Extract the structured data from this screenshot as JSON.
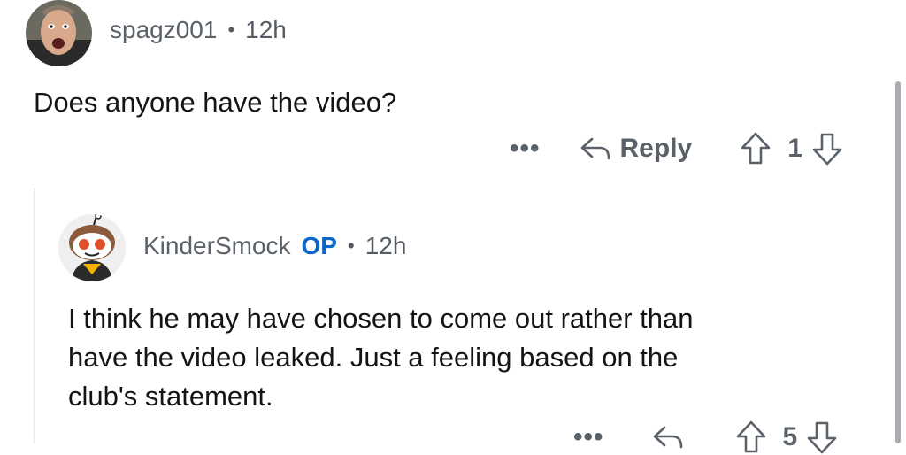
{
  "comment": {
    "username": "spagz001",
    "separator": "•",
    "time": "12h",
    "body": "Does anyone have the video?",
    "more_label": "•••",
    "reply_label": "Reply",
    "vote_count": "1"
  },
  "reply": {
    "username": "KinderSmock",
    "op_badge": "OP",
    "separator": "•",
    "time": "12h",
    "body_lines": [
      "I think he may have chosen to come out rather than",
      "have the video leaked. Just a feeling based on the",
      "club's statement."
    ],
    "more_label": "•••",
    "vote_count": "5"
  },
  "icons": {
    "reply": "reply-arrow-icon",
    "upvote": "upvote-arrow-icon",
    "downvote": "downvote-arrow-icon",
    "more": "more-dots-icon"
  },
  "colors": {
    "text": "#141414",
    "meta": "#555b62",
    "op_badge": "#0a66c8",
    "thread_line": "#e4e6e8"
  }
}
